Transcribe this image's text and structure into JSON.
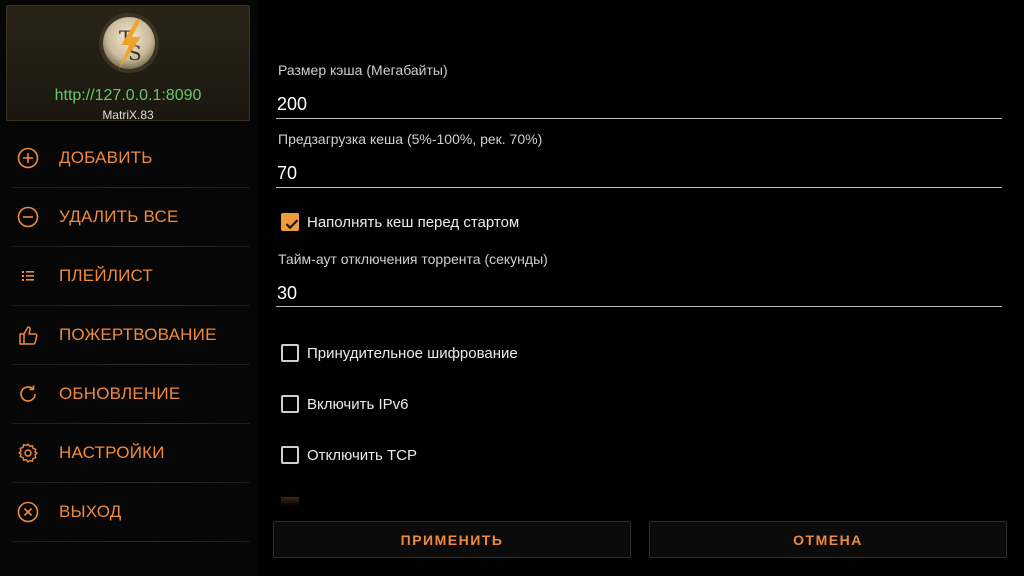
{
  "header": {
    "server_url": "http://127.0.0.1:8090",
    "device_name": "MatriX.83",
    "logo_letters": "TS"
  },
  "sidebar": {
    "items": [
      {
        "label": "ДОБАВИТЬ",
        "icon": "plus-circle-icon"
      },
      {
        "label": "УДАЛИТЬ ВСЕ",
        "icon": "minus-circle-icon"
      },
      {
        "label": "ПЛЕЙЛИСТ",
        "icon": "list-icon"
      },
      {
        "label": "ПОЖЕРТВОВАНИЕ",
        "icon": "thumbs-up-icon"
      },
      {
        "label": "ОБНОВЛЕНИЕ",
        "icon": "refresh-icon"
      },
      {
        "label": "НАСТРОЙКИ",
        "icon": "gear-icon"
      },
      {
        "label": "ВЫХОД",
        "icon": "close-circle-icon"
      }
    ]
  },
  "settings": {
    "cache_size": {
      "label": "Размер кэша (Мегабайты)",
      "value": "200"
    },
    "preload": {
      "label": "Предзагрузка кеша (5%-100%, рек. 70%)",
      "value": "70"
    },
    "fill_cache": {
      "label": "Наполнять кеш перед стартом",
      "checked": true
    },
    "timeout": {
      "label": "Тайм-аут отключения торрента (секунды)",
      "value": "30"
    },
    "force_encryption": {
      "label": "Принудительное шифрование",
      "checked": false
    },
    "enable_ipv6": {
      "label": "Включить IPv6",
      "checked": false
    },
    "disable_tcp": {
      "label": "Отключить TCP",
      "checked": false
    }
  },
  "buttons": {
    "apply": "ПРИМЕНИТЬ",
    "cancel": "ОТМЕНА"
  },
  "colors": {
    "accent": "#f08a3c",
    "url_green": "#64c868",
    "checkbox_on": "#f19a3b"
  }
}
